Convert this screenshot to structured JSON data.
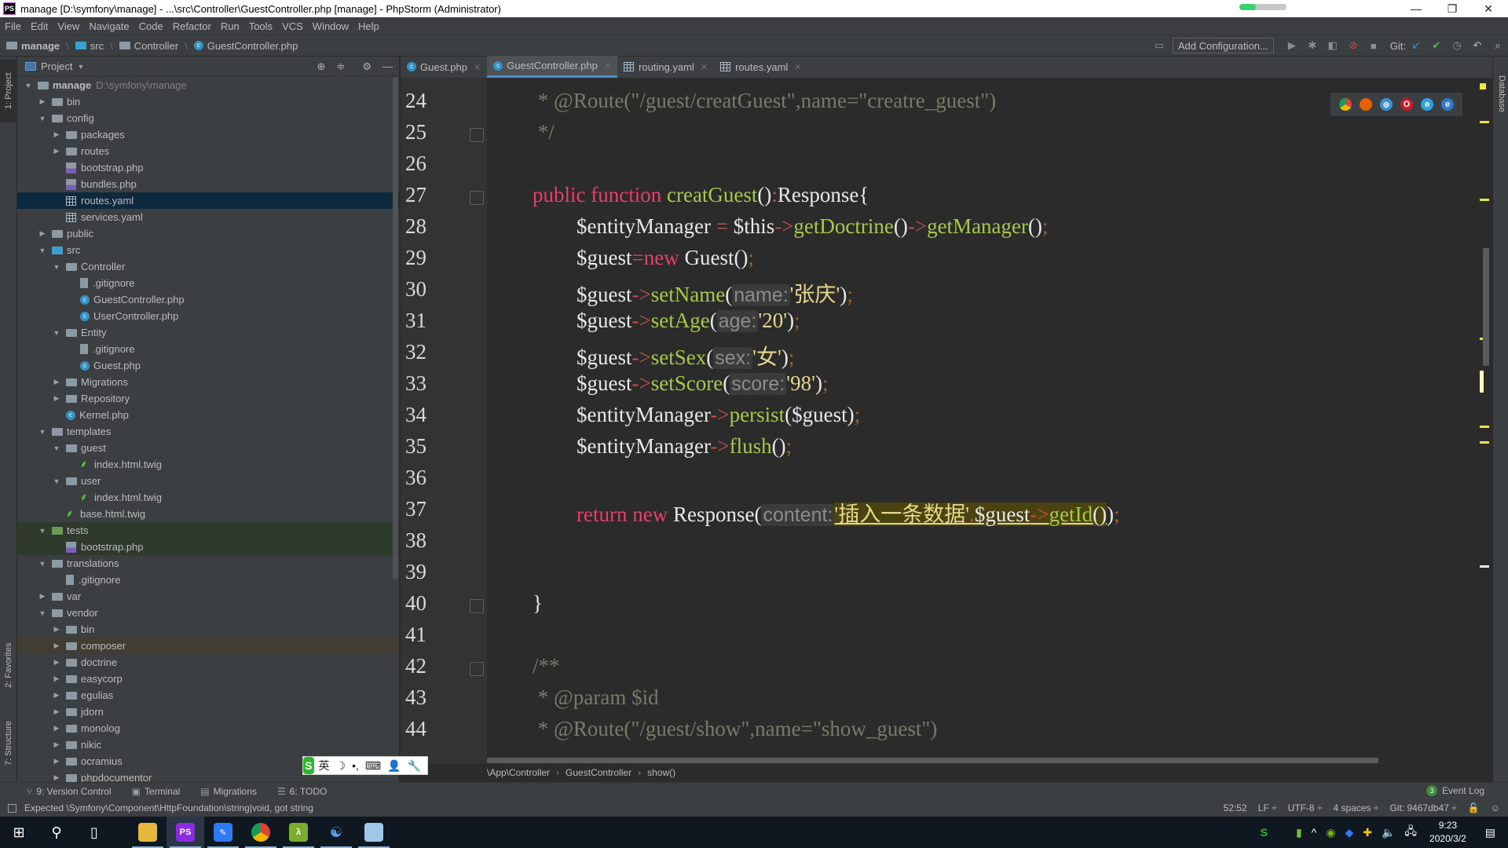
{
  "window": {
    "title": "manage [D:\\symfony\\manage] - ...\\src\\Controller\\GuestController.php [manage] - PhpStorm (Administrator)",
    "app_icon": "PS",
    "progress": 0.35,
    "controls": {
      "minimize": "—",
      "maximize": "❐",
      "close": "✕"
    }
  },
  "menu": [
    "File",
    "Edit",
    "View",
    "Navigate",
    "Code",
    "Refactor",
    "Run",
    "Tools",
    "VCS",
    "Window",
    "Help"
  ],
  "navbar": {
    "crumbs": [
      "manage",
      "src",
      "Controller",
      "GuestController.php"
    ],
    "add_configuration": "Add Configuration...",
    "git_label": "Git:"
  },
  "left_stripe": {
    "project": "1: Project",
    "favorites": "2: Favorites",
    "structure": "7: Structure"
  },
  "right_stripe": {
    "database": "Database"
  },
  "project_panel": {
    "title": "Project",
    "tree": [
      {
        "label": "manage",
        "hint": "D:\\symfony\\manage",
        "type": "folder",
        "depth": 0,
        "expanded": true,
        "bold": true
      },
      {
        "label": "bin",
        "type": "folder",
        "depth": 1,
        "expanded": false
      },
      {
        "label": "config",
        "type": "folder",
        "depth": 1,
        "expanded": true
      },
      {
        "label": "packages",
        "type": "folder",
        "depth": 2,
        "expanded": false
      },
      {
        "label": "routes",
        "type": "folder",
        "depth": 2,
        "expanded": false
      },
      {
        "label": "bootstrap.php",
        "type": "php",
        "depth": 2
      },
      {
        "label": "bundles.php",
        "type": "php",
        "depth": 2
      },
      {
        "label": "routes.yaml",
        "type": "yaml",
        "depth": 2,
        "selected": true
      },
      {
        "label": "services.yaml",
        "type": "yaml",
        "depth": 2
      },
      {
        "label": "public",
        "type": "folder",
        "depth": 1,
        "expanded": false
      },
      {
        "label": "src",
        "type": "folder-blue",
        "depth": 1,
        "expanded": true
      },
      {
        "label": "Controller",
        "type": "folder",
        "depth": 2,
        "expanded": true
      },
      {
        "label": ".gitignore",
        "type": "txt",
        "depth": 3
      },
      {
        "label": "GuestController.php",
        "type": "class",
        "depth": 3
      },
      {
        "label": "UserController.php",
        "type": "class",
        "depth": 3
      },
      {
        "label": "Entity",
        "type": "folder",
        "depth": 2,
        "expanded": true
      },
      {
        "label": ".gitignore",
        "type": "txt",
        "depth": 3
      },
      {
        "label": "Guest.php",
        "type": "class",
        "depth": 3
      },
      {
        "label": "Migrations",
        "type": "folder",
        "depth": 2,
        "expanded": false
      },
      {
        "label": "Repository",
        "type": "folder",
        "depth": 2,
        "expanded": false
      },
      {
        "label": "Kernel.php",
        "type": "class",
        "depth": 2
      },
      {
        "label": "templates",
        "type": "folder",
        "depth": 1,
        "expanded": true
      },
      {
        "label": "guest",
        "type": "folder",
        "depth": 2,
        "expanded": true
      },
      {
        "label": "index.html.twig",
        "type": "twig",
        "depth": 3
      },
      {
        "label": "user",
        "type": "folder",
        "depth": 2,
        "expanded": true
      },
      {
        "label": "index.html.twig",
        "type": "twig",
        "depth": 3
      },
      {
        "label": "base.html.twig",
        "type": "twig",
        "depth": 2
      },
      {
        "label": "tests",
        "type": "folder-green",
        "depth": 1,
        "expanded": true,
        "test": true
      },
      {
        "label": "bootstrap.php",
        "type": "php",
        "depth": 2,
        "test": true
      },
      {
        "label": "translations",
        "type": "folder",
        "depth": 1,
        "expanded": true
      },
      {
        "label": ".gitignore",
        "type": "txt",
        "depth": 2
      },
      {
        "label": "var",
        "type": "folder",
        "depth": 1,
        "expanded": false
      },
      {
        "label": "vendor",
        "type": "folder",
        "depth": 1,
        "expanded": true
      },
      {
        "label": "bin",
        "type": "folder",
        "depth": 2,
        "expanded": false
      },
      {
        "label": "composer",
        "type": "folder",
        "depth": 2,
        "expanded": false,
        "highlight": true
      },
      {
        "label": "doctrine",
        "type": "folder",
        "depth": 2,
        "expanded": false
      },
      {
        "label": "easycorp",
        "type": "folder",
        "depth": 2,
        "expanded": false
      },
      {
        "label": "egulias",
        "type": "folder",
        "depth": 2,
        "expanded": false
      },
      {
        "label": "jdorn",
        "type": "folder",
        "depth": 2,
        "expanded": false
      },
      {
        "label": "monolog",
        "type": "folder",
        "depth": 2,
        "expanded": false
      },
      {
        "label": "nikic",
        "type": "folder",
        "depth": 2,
        "expanded": false
      },
      {
        "label": "ocramius",
        "type": "folder",
        "depth": 2,
        "expanded": false
      },
      {
        "label": "phpdocumentor",
        "type": "folder",
        "depth": 2,
        "expanded": false
      }
    ]
  },
  "tabs": [
    {
      "label": "Guest.php",
      "icon": "class",
      "active": false
    },
    {
      "label": "GuestController.php",
      "icon": "class",
      "active": true
    },
    {
      "label": "routing.yaml",
      "icon": "yaml",
      "active": false
    },
    {
      "label": "routes.yaml",
      "icon": "yaml",
      "active": false
    }
  ],
  "editor": {
    "lines": [
      {
        "n": "24",
        "indent": 0,
        "tokens": [
          {
            "c": "cm",
            "t": " * @Route(\"/guest/creatGuest\",name=\"creatre_guest\")"
          }
        ]
      },
      {
        "n": "25",
        "indent": 0,
        "fold": true,
        "tokens": [
          {
            "c": "cm",
            "t": " */"
          }
        ]
      },
      {
        "n": "26",
        "indent": 0,
        "tokens": []
      },
      {
        "n": "27",
        "indent": 0,
        "fold": true,
        "tokens": [
          {
            "c": "kw",
            "t": "public "
          },
          {
            "c": "kw",
            "t": "function "
          },
          {
            "c": "fn",
            "t": "creatGuest"
          },
          {
            "c": "",
            "t": "()"
          },
          {
            "c": "op",
            "t": ":"
          },
          {
            "c": "",
            "t": "Response{"
          }
        ]
      },
      {
        "n": "28",
        "indent": 1,
        "tokens": [
          {
            "c": "",
            "t": "$entityManager "
          },
          {
            "c": "op",
            "t": "= "
          },
          {
            "c": "",
            "t": "$this"
          },
          {
            "c": "op",
            "t": "->"
          },
          {
            "c": "fn",
            "t": "getDoctrine"
          },
          {
            "c": "",
            "t": "()"
          },
          {
            "c": "op",
            "t": "->"
          },
          {
            "c": "fn",
            "t": "getManager"
          },
          {
            "c": "",
            "t": "()"
          },
          {
            "c": "semi",
            "t": ";"
          }
        ]
      },
      {
        "n": "29",
        "indent": 1,
        "tokens": [
          {
            "c": "",
            "t": "$guest"
          },
          {
            "c": "op",
            "t": "="
          },
          {
            "c": "kw",
            "t": "new "
          },
          {
            "c": "",
            "t": "Guest()"
          },
          {
            "c": "semi",
            "t": ";"
          }
        ]
      },
      {
        "n": "30",
        "indent": 1,
        "tokens": [
          {
            "c": "",
            "t": "$guest"
          },
          {
            "c": "op",
            "t": "->"
          },
          {
            "c": "fn",
            "t": "setName"
          },
          {
            "c": "",
            "t": "("
          },
          {
            "c": "ph",
            "t": "name:"
          },
          {
            "c": "str",
            "t": "'张庆'"
          },
          {
            "c": "",
            "t": ")"
          },
          {
            "c": "semi",
            "t": ";"
          }
        ]
      },
      {
        "n": "31",
        "indent": 1,
        "tokens": [
          {
            "c": "",
            "t": "$guest"
          },
          {
            "c": "op",
            "t": "->"
          },
          {
            "c": "fn",
            "t": "setAge"
          },
          {
            "c": "",
            "t": "("
          },
          {
            "c": "ph",
            "t": "age:"
          },
          {
            "c": "str",
            "t": "'20'"
          },
          {
            "c": "",
            "t": ")"
          },
          {
            "c": "semi",
            "t": ";"
          }
        ]
      },
      {
        "n": "32",
        "indent": 1,
        "tokens": [
          {
            "c": "",
            "t": "$guest"
          },
          {
            "c": "op",
            "t": "->"
          },
          {
            "c": "fn",
            "t": "setSex"
          },
          {
            "c": "",
            "t": "("
          },
          {
            "c": "ph",
            "t": "sex:"
          },
          {
            "c": "str",
            "t": "'女'"
          },
          {
            "c": "",
            "t": ")"
          },
          {
            "c": "semi",
            "t": ";"
          }
        ]
      },
      {
        "n": "33",
        "indent": 1,
        "tokens": [
          {
            "c": "",
            "t": "$guest"
          },
          {
            "c": "op",
            "t": "->"
          },
          {
            "c": "fn",
            "t": "setScore"
          },
          {
            "c": "",
            "t": "("
          },
          {
            "c": "ph",
            "t": "score:"
          },
          {
            "c": "str",
            "t": "'98'"
          },
          {
            "c": "",
            "t": ")"
          },
          {
            "c": "semi",
            "t": ";"
          }
        ]
      },
      {
        "n": "34",
        "indent": 1,
        "tokens": [
          {
            "c": "",
            "t": "$entityManager"
          },
          {
            "c": "op",
            "t": "->"
          },
          {
            "c": "fn",
            "t": "persist"
          },
          {
            "c": "",
            "t": "($guest)"
          },
          {
            "c": "semi",
            "t": ";"
          }
        ]
      },
      {
        "n": "35",
        "indent": 1,
        "tokens": [
          {
            "c": "",
            "t": "$entityManager"
          },
          {
            "c": "op",
            "t": "->"
          },
          {
            "c": "fn",
            "t": "flush"
          },
          {
            "c": "",
            "t": "()"
          },
          {
            "c": "semi",
            "t": ";"
          }
        ]
      },
      {
        "n": "36",
        "indent": 0,
        "tokens": []
      },
      {
        "n": "37",
        "indent": 1,
        "tokens": [
          {
            "c": "kw",
            "t": "return "
          },
          {
            "c": "kw",
            "t": "new "
          },
          {
            "c": "",
            "t": "Response("
          },
          {
            "c": "ph",
            "t": "content:"
          },
          {
            "c": "str hlbox",
            "t": "'插入一条数据'"
          },
          {
            "c": "op hlbox",
            "t": "."
          },
          {
            "c": "hlbox",
            "t": "$guest"
          },
          {
            "c": "op hlbox",
            "t": "->"
          },
          {
            "c": "fn hlbox",
            "t": "getId"
          },
          {
            "c": "hlbox",
            "t": "()"
          },
          {
            "c": "",
            "t": ")"
          },
          {
            "c": "semi",
            "t": ";"
          }
        ]
      },
      {
        "n": "38",
        "indent": 0,
        "tokens": []
      },
      {
        "n": "39",
        "indent": 0,
        "tokens": []
      },
      {
        "n": "40",
        "indent": 0,
        "fold": true,
        "tokens": [
          {
            "c": "",
            "t": "}"
          }
        ]
      },
      {
        "n": "41",
        "indent": 0,
        "tokens": []
      },
      {
        "n": "42",
        "indent": 0,
        "fold": true,
        "tokens": [
          {
            "c": "cm",
            "t": "/**"
          }
        ]
      },
      {
        "n": "43",
        "indent": 0,
        "tokens": [
          {
            "c": "cm",
            "t": " * @param $id"
          }
        ]
      },
      {
        "n": "44",
        "indent": 0,
        "tokens": [
          {
            "c": "cm",
            "t": " * @Route(\"/guest/show\",name=\"show_guest\")"
          }
        ]
      }
    ],
    "browsers": [
      "chrome",
      "firefox",
      "safari",
      "opera",
      "ie",
      "edge"
    ]
  },
  "breadcrumb": [
    "\\App\\Controller",
    "GuestController",
    "show()"
  ],
  "ime": {
    "logo": "S",
    "mode": "英",
    "items": [
      "☽",
      "•,",
      "⌨",
      "👤",
      "🔧"
    ]
  },
  "tool_windows": [
    {
      "label": "9: Version Control",
      "icon": "⑂"
    },
    {
      "label": "Terminal",
      "icon": "▣"
    },
    {
      "label": "Migrations",
      "icon": "▤"
    },
    {
      "label": "6: TODO",
      "icon": "☰"
    }
  ],
  "event_log": {
    "count": "3",
    "label": "Event Log"
  },
  "status": {
    "message": "Expected \\Symfony\\Component\\HttpFoundation\\string|void, got string",
    "position": "52:52",
    "line_sep": "LF ÷",
    "encoding": "UTF-8 ÷",
    "indent": "4 spaces ÷",
    "git": "Git: 9467db47 ÷"
  },
  "taskbar": {
    "apps": [
      "file-explorer",
      "phpstorm",
      "feishu",
      "chrome",
      "lambda",
      "navicat",
      "notepad"
    ],
    "clock_time": "9:23",
    "clock_date": "2020/3/2"
  },
  "colors": {
    "accent": "#4a88c7",
    "keyword": "#e83e6a",
    "function": "#a6c94a",
    "string": "#e5d88c",
    "comment": "#7a7a6a",
    "selection": "#0d293e"
  }
}
